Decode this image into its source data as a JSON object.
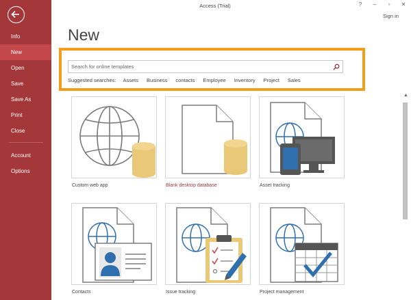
{
  "window": {
    "title": "Access (Trial)",
    "sign_in": "Sign in",
    "controls": [
      "?",
      "–",
      "▫",
      "✕"
    ]
  },
  "sidebar": {
    "accent_color": "#a4373a",
    "items": [
      {
        "label": "Info"
      },
      {
        "label": "New",
        "active": true
      },
      {
        "label": "Open"
      },
      {
        "label": "Save"
      },
      {
        "label": "Save As"
      },
      {
        "label": "Print"
      },
      {
        "label": "Close"
      },
      {
        "label": "Account"
      },
      {
        "label": "Options"
      }
    ]
  },
  "page": {
    "title": "New"
  },
  "search": {
    "placeholder": "Search for online templates",
    "suggested_label": "Suggested searches:",
    "suggestions": [
      "Assets",
      "Business",
      "contacts",
      "Employee",
      "Inventory",
      "Project",
      "Sales"
    ],
    "highlight_color": "#f59c1b"
  },
  "templates": [
    {
      "label": "Custom web app",
      "icon": "globe-database-icon"
    },
    {
      "label": "Blank desktop database",
      "icon": "document-database-icon",
      "highlighted": true
    },
    {
      "label": "Asset tracking",
      "icon": "document-devices-icon"
    },
    {
      "label": "Contacts",
      "icon": "document-contact-card-icon"
    },
    {
      "label": "Issue tracking",
      "icon": "document-clipboard-icon"
    },
    {
      "label": "Project management",
      "icon": "document-calendar-icon"
    }
  ]
}
